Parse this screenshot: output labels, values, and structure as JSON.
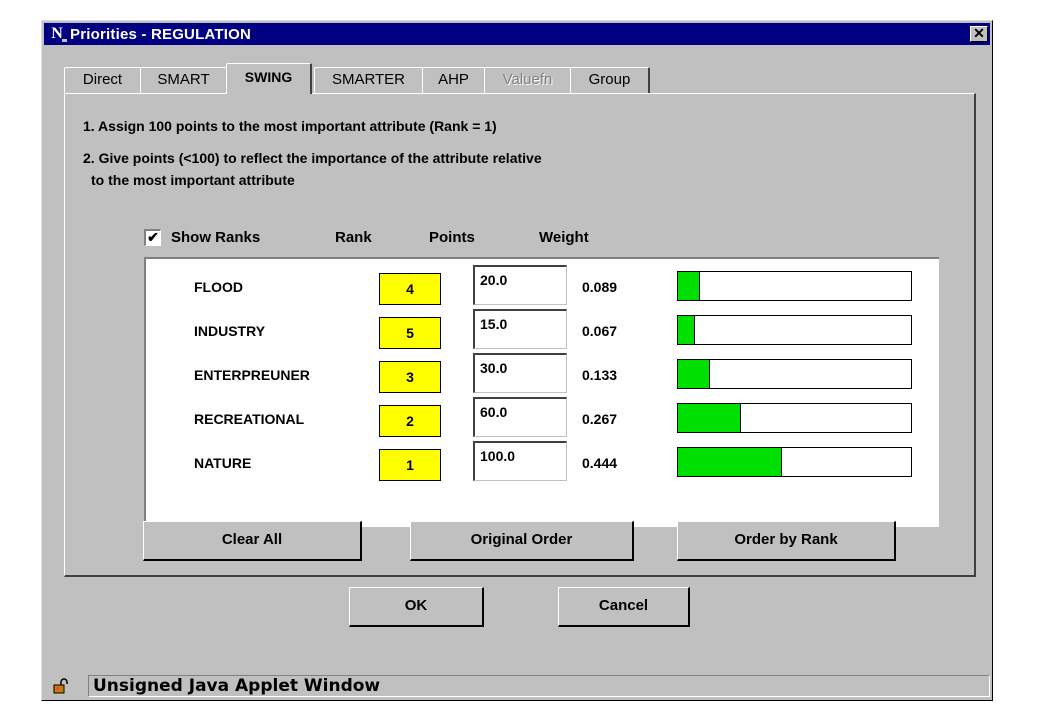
{
  "window": {
    "title": "Priorities - REGULATION",
    "icon": "netscape-n-icon",
    "close_symbol": "✕"
  },
  "tabs": [
    {
      "label": "Direct",
      "active": false,
      "disabled": false
    },
    {
      "label": "SMART",
      "active": false,
      "disabled": false
    },
    {
      "label": "SWING",
      "active": true,
      "disabled": false
    },
    {
      "label": "SMARTER",
      "active": false,
      "disabled": false
    },
    {
      "label": "AHP",
      "active": false,
      "disabled": false
    },
    {
      "label": "Valuefn",
      "active": false,
      "disabled": true
    },
    {
      "label": "Group",
      "active": false,
      "disabled": false
    }
  ],
  "instructions": {
    "line1": "1. Assign 100 points to the most important attribute (Rank = 1)",
    "line2a": "2. Give points (<100) to reflect the importance of the attribute relative",
    "line2b": "to the most important attribute"
  },
  "show_ranks": {
    "label": "Show Ranks",
    "checked": true,
    "check_glyph": "✔"
  },
  "columns": {
    "rank": "Rank",
    "points": "Points",
    "weight": "Weight"
  },
  "attributes": [
    {
      "name": "FLOOD",
      "rank": "4",
      "points": "20.0",
      "weight": "0.089",
      "weight_fraction": 0.089
    },
    {
      "name": "INDUSTRY",
      "rank": "5",
      "points": "15.0",
      "weight": "0.067",
      "weight_fraction": 0.067
    },
    {
      "name": "ENTERPREUNER",
      "rank": "3",
      "points": "30.0",
      "weight": "0.133",
      "weight_fraction": 0.133
    },
    {
      "name": "RECREATIONAL",
      "rank": "2",
      "points": "60.0",
      "weight": "0.267",
      "weight_fraction": 0.267
    },
    {
      "name": "NATURE",
      "rank": "1",
      "points": "100.0",
      "weight": "0.444",
      "weight_fraction": 0.444
    }
  ],
  "buttons": {
    "clear_all": "Clear All",
    "original_order": "Original Order",
    "order_by_rank": "Order by Rank",
    "ok": "OK",
    "cancel": "Cancel"
  },
  "status": {
    "text": "Unsigned Java Applet Window",
    "icon": "unlocked-padlock-icon"
  },
  "colors": {
    "titlebar": "#000080",
    "rank_highlight": "#ffff00",
    "weight_fill": "#00e000",
    "window_face": "#c0c0c0"
  }
}
